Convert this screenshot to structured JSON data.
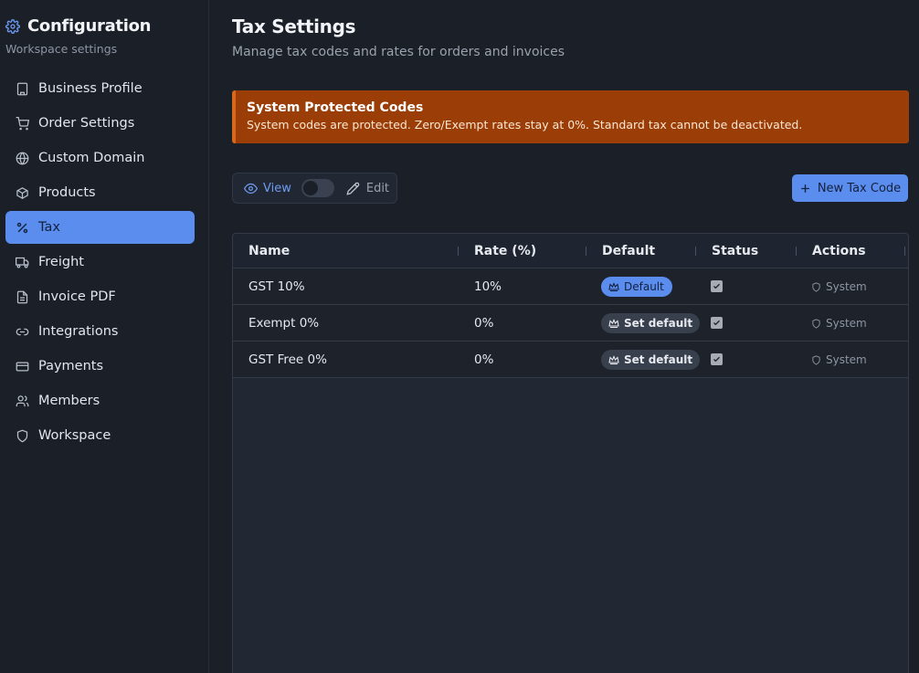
{
  "sidebar": {
    "title": "Configuration",
    "subtitle": "Workspace settings",
    "items": [
      {
        "label": "Business Profile",
        "icon": "building-icon"
      },
      {
        "label": "Order Settings",
        "icon": "cart-icon"
      },
      {
        "label": "Custom Domain",
        "icon": "globe-icon"
      },
      {
        "label": "Products",
        "icon": "box-icon"
      },
      {
        "label": "Tax",
        "icon": "percent-icon",
        "active": true
      },
      {
        "label": "Freight",
        "icon": "truck-icon"
      },
      {
        "label": "Invoice PDF",
        "icon": "document-icon"
      },
      {
        "label": "Integrations",
        "icon": "link-icon"
      },
      {
        "label": "Payments",
        "icon": "credit-card-icon"
      },
      {
        "label": "Members",
        "icon": "users-icon"
      },
      {
        "label": "Workspace",
        "icon": "shield-icon"
      }
    ]
  },
  "header": {
    "title": "Tax Settings",
    "subtitle": "Manage tax codes and rates for orders and invoices"
  },
  "alert": {
    "title": "System Protected Codes",
    "text": "System codes are protected. Zero/Exempt rates stay at 0%. Standard tax cannot be deactivated."
  },
  "toolbar": {
    "view_label": "View",
    "edit_label": "Edit",
    "new_button": "New Tax Code",
    "edit_mode": false
  },
  "table": {
    "columns": [
      "Name",
      "Rate (%)",
      "Default",
      "Status",
      "Actions"
    ],
    "rows": [
      {
        "name": "GST 10%",
        "rate": "10%",
        "default_label": "Default",
        "is_default": true,
        "status_checked": true,
        "action": "System"
      },
      {
        "name": "Exempt 0%",
        "rate": "0%",
        "default_label": "Set default",
        "is_default": false,
        "status_checked": true,
        "action": "System"
      },
      {
        "name": "GST Free 0%",
        "rate": "0%",
        "default_label": "Set default",
        "is_default": false,
        "status_checked": true,
        "action": "System"
      }
    ]
  },
  "colors": {
    "accent": "#5b8def",
    "alert_bg": "#9a3d06",
    "background": "#1a1f28"
  }
}
